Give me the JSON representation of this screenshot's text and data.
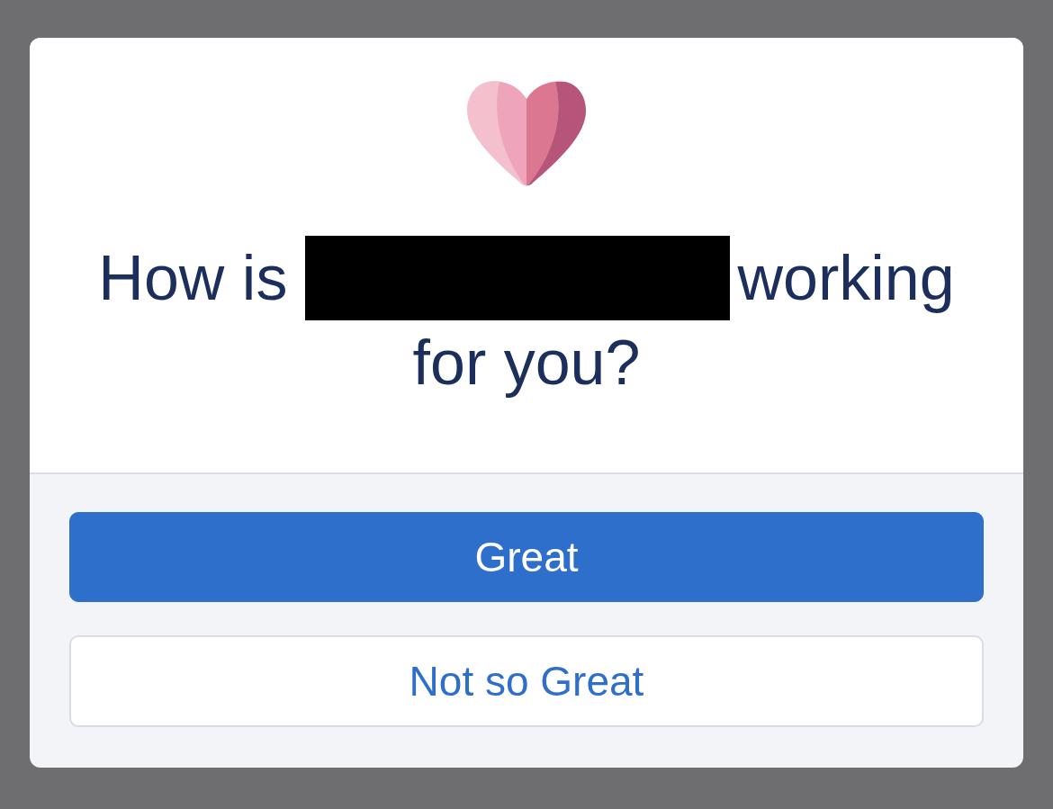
{
  "question": {
    "line_1": {
      "before_redaction": "How is",
      "after_redaction": "working"
    },
    "line_2": "for you?",
    "redacted": true
  },
  "buttons": [
    {
      "label": "Great",
      "kind": "primary"
    },
    {
      "label": "Not so Great",
      "kind": "secondary"
    }
  ]
}
